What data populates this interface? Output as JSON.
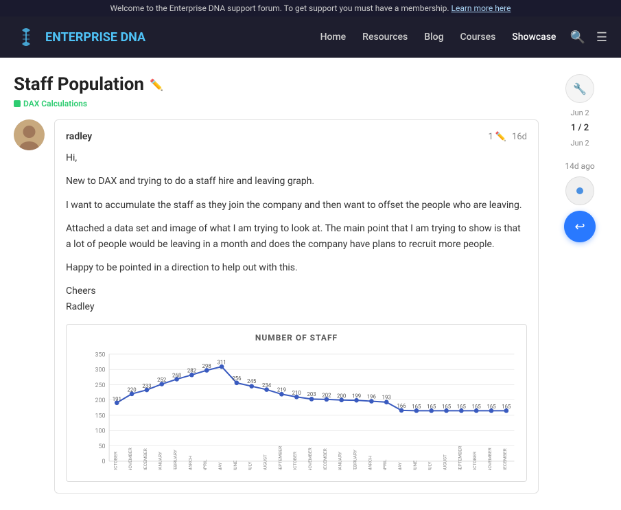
{
  "banner": {
    "text": "Welcome to the Enterprise DNA support forum. To get support you must have a membership.",
    "link_text": "Learn more here"
  },
  "navbar": {
    "logo_text_plain": "ENTERPRISE ",
    "logo_text_accent": "DNA",
    "nav_items": [
      {
        "label": "Home",
        "active": false
      },
      {
        "label": "Resources",
        "active": false
      },
      {
        "label": "Blog",
        "active": false
      },
      {
        "label": "Courses",
        "active": false
      },
      {
        "label": "Showcase",
        "active": true
      }
    ]
  },
  "page": {
    "title": "Staff Population",
    "tag": "DAX Calculations"
  },
  "post": {
    "author": "radley",
    "edit_count": "1",
    "timestamp": "16d",
    "body_lines": [
      "Hi,",
      "New to DAX and trying to do a staff hire and leaving graph.",
      "I want to accumulate the staff as they join the company and then want to offset the people who are leaving.",
      "Attached a data set and image of what I am trying to look at. The main point that I am trying to show is that a lot of people would be leaving in a month and does the company have plans to recruit more people.",
      "Happy to be pointed in a direction to help out with this.",
      "Cheers\nRadley"
    ]
  },
  "chart": {
    "title": "NUMBER OF STAFF",
    "y_max": 350,
    "y_ticks": [
      0,
      50,
      100,
      150,
      200,
      250,
      300,
      350
    ],
    "data_points": [
      {
        "label": "OCTOBER",
        "value": 191
      },
      {
        "label": "NOVEMBER",
        "value": 220
      },
      {
        "label": "DECEMBER",
        "value": 233
      },
      {
        "label": "JANUARY",
        "value": 252
      },
      {
        "label": "FEBRUARY",
        "value": 268
      },
      {
        "label": "MARCH",
        "value": 282
      },
      {
        "label": "APRIL",
        "value": 298
      },
      {
        "label": "MAY",
        "value": 311
      },
      {
        "label": "JUNE",
        "value": 256
      },
      {
        "label": "JULY",
        "value": 245
      },
      {
        "label": "AUGUST",
        "value": 234
      },
      {
        "label": "SEPTEMBER",
        "value": 219
      },
      {
        "label": "OCTOBER",
        "value": 210
      },
      {
        "label": "NOVEMBER",
        "value": 203
      },
      {
        "label": "DECEMBER",
        "value": 202
      },
      {
        "label": "JANUARY",
        "value": 200
      },
      {
        "label": "FEBRUARY",
        "value": 199
      },
      {
        "label": "MARCH",
        "value": 196
      },
      {
        "label": "APRIL",
        "value": 193
      },
      {
        "label": "MAY",
        "value": 166
      },
      {
        "label": "JUNE",
        "value": 165
      },
      {
        "label": "JULY",
        "value": 165
      },
      {
        "label": "AUGUST",
        "value": 165
      },
      {
        "label": "SEPTEMBER",
        "value": 165
      },
      {
        "label": "OCTOBER",
        "value": 165
      },
      {
        "label": "NOVEMBER",
        "value": 165
      },
      {
        "label": "DECEMBER",
        "value": 165
      }
    ]
  },
  "sidebar": {
    "date1": "Jun 2",
    "pagination": "1 / 2",
    "date2": "Jun 2",
    "time_ago": "14d ago",
    "reply_icon": "↩"
  }
}
